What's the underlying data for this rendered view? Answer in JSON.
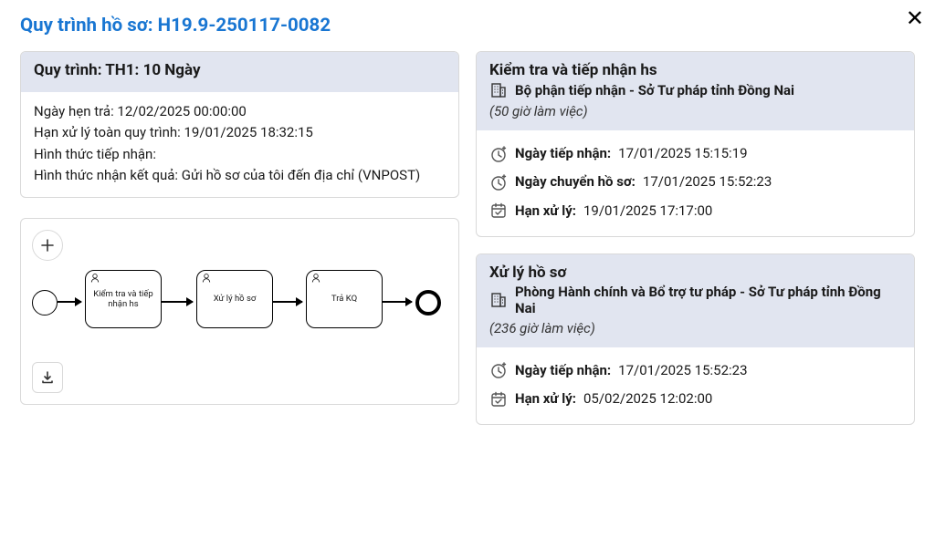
{
  "title_prefix": "Quy trình hồ sơ: ",
  "case_number": "H19.9-250117-0082",
  "process": {
    "header": "Quy trình: TH1: 10 Ngày",
    "return_date_label": "Ngày hẹn trả: ",
    "return_date_value": "12/02/2025 00:00:00",
    "deadline_label": "Hạn xử lý toàn quy trình: ",
    "deadline_value": "19/01/2025 18:32:15",
    "receipt_method_label": "Hình thức tiếp nhận:",
    "result_method_label": "Hình thức nhận kết quả: ",
    "result_method_value": "Gửi hồ sơ của tôi đến địa chỉ (VNPOST)"
  },
  "diagram": {
    "task1": "Kiểm tra và tiếp nhận hs",
    "task2": "Xử lý hồ sơ",
    "task3": "Trả KQ"
  },
  "steps": [
    {
      "title": "Kiểm tra và tiếp nhận hs",
      "department": "Bộ phận tiếp nhận - Sở Tư pháp tỉnh Đồng Nai",
      "hours": "(50 giờ làm việc)",
      "rows": [
        {
          "icon": "clock-plus",
          "label": "Ngày tiếp nhận: ",
          "value": "17/01/2025 15:15:19"
        },
        {
          "icon": "clock-plus",
          "label": "Ngày chuyển hồ sơ: ",
          "value": "17/01/2025 15:52:23"
        },
        {
          "icon": "calendar-check",
          "label": "Hạn xử lý: ",
          "value": "19/01/2025 17:17:00"
        }
      ]
    },
    {
      "title": "Xử lý hồ sơ",
      "department": "Phòng Hành chính và Bổ trợ tư pháp - Sở Tư pháp tỉnh Đồng Nai",
      "hours": "(236 giờ làm việc)",
      "rows": [
        {
          "icon": "clock-plus",
          "label": "Ngày tiếp nhận: ",
          "value": "17/01/2025 15:52:23"
        },
        {
          "icon": "calendar-check",
          "label": "Hạn xử lý: ",
          "value": "05/02/2025 12:02:00"
        }
      ]
    }
  ]
}
